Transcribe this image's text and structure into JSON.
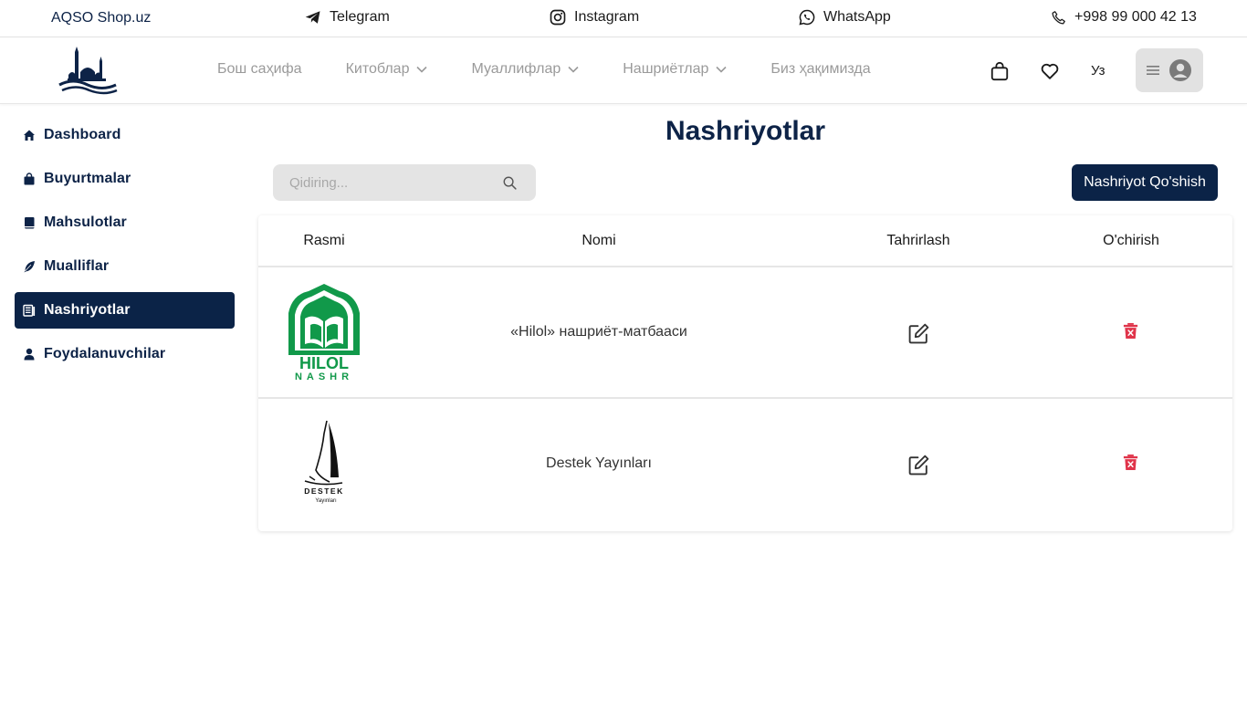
{
  "topbar": {
    "brand": "AQSO Shop.uz",
    "telegram": "Telegram",
    "instagram": "Instagram",
    "whatsapp": "WhatsApp",
    "phone": "+998 99 000 42 13"
  },
  "nav": {
    "items": [
      {
        "label": "Бош саҳифа",
        "dropdown": false
      },
      {
        "label": "Китоблар",
        "dropdown": true
      },
      {
        "label": "Муаллифлар",
        "dropdown": true
      },
      {
        "label": "Нашриётлар",
        "dropdown": true
      },
      {
        "label": "Биз ҳақимизда",
        "dropdown": false
      }
    ],
    "lang": "Уз"
  },
  "sidebar": {
    "items": [
      {
        "label": "Dashboard",
        "icon": "home-icon",
        "active": false
      },
      {
        "label": "Buyurtmalar",
        "icon": "shopping-bag-icon",
        "active": false
      },
      {
        "label": "Mahsulotlar",
        "icon": "book-icon",
        "active": false
      },
      {
        "label": "Mualliflar",
        "icon": "feather-icon",
        "active": false
      },
      {
        "label": "Nashriyotlar",
        "icon": "publisher-icon",
        "active": true
      },
      {
        "label": "Foydalanuvchilar",
        "icon": "user-icon",
        "active": false
      }
    ]
  },
  "main": {
    "title": "Nashriyotlar",
    "search_placeholder": "Qidiring...",
    "add_button": "Nashriyot Qo'shish",
    "table": {
      "headers": [
        "Rasmi",
        "Nomi",
        "Tahrirlash",
        "O'chirish"
      ],
      "rows": [
        {
          "name": "«Hilol» нашриёт-матбааси",
          "logo_text_1": "HILOL",
          "logo_text_2": "NASHR"
        },
        {
          "name": "Destek Yayınları",
          "logo_text_1": "DESTEK",
          "logo_text_2": "Yayınları"
        }
      ]
    }
  },
  "colors": {
    "primary": "#0b2347",
    "delete": "#e0344a",
    "hilol_green": "#119944"
  }
}
